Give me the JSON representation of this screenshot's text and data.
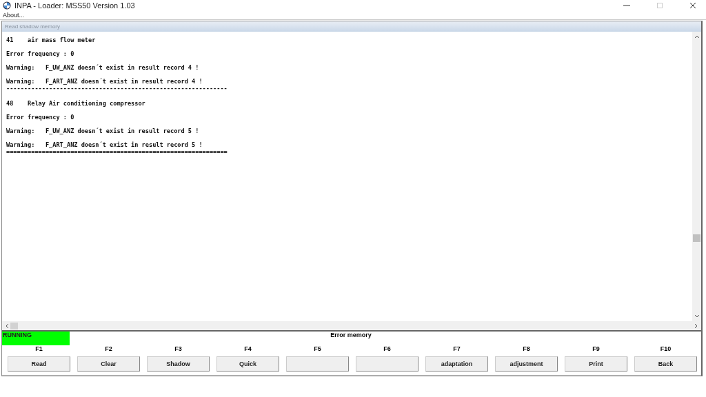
{
  "window": {
    "title": "INPA - Loader:  MSS50 Version 1.03"
  },
  "menu": [
    {
      "label": "About..."
    }
  ],
  "panel": {
    "title": "Read shadow memory",
    "lines": [
      {
        "kind": "text",
        "text": "41    air mass flow meter"
      },
      {
        "kind": "text",
        "text": "Error frequency : 0"
      },
      {
        "kind": "text",
        "text": "Warning:   F_UW_ANZ doesn´t exist in result record 4 !"
      },
      {
        "kind": "text",
        "text": "Warning:   F_ART_ANZ doesn´t exist in result record 4 !"
      },
      {
        "kind": "rule",
        "text": "--------------------------------------------------------------"
      },
      {
        "kind": "text",
        "text": "48    Relay Air conditioning compressor"
      },
      {
        "kind": "text",
        "text": "Error frequency : 0"
      },
      {
        "kind": "text",
        "text": "Warning:   F_UW_ANZ doesn´t exist in result record 5 !"
      },
      {
        "kind": "text",
        "text": "Warning:   F_ART_ANZ doesn´t exist in result record 5 !"
      },
      {
        "kind": "rule",
        "text": "=============================================================="
      }
    ]
  },
  "status": {
    "text": "RUNNING",
    "color": "#00ff00"
  },
  "section": "Error memory",
  "function_keys": [
    {
      "key": "F1",
      "label": "Read"
    },
    {
      "key": "F2",
      "label": "Clear"
    },
    {
      "key": "F3",
      "label": "Shadow"
    },
    {
      "key": "F4",
      "label": "Quick"
    },
    {
      "key": "F5"
    },
    {
      "key": "F6"
    },
    {
      "key": "F7",
      "label": "adaptation"
    },
    {
      "key": "F8",
      "label": "adjustment"
    },
    {
      "key": "F9",
      "label": "Print"
    },
    {
      "key": "F10",
      "label": "Back"
    }
  ]
}
